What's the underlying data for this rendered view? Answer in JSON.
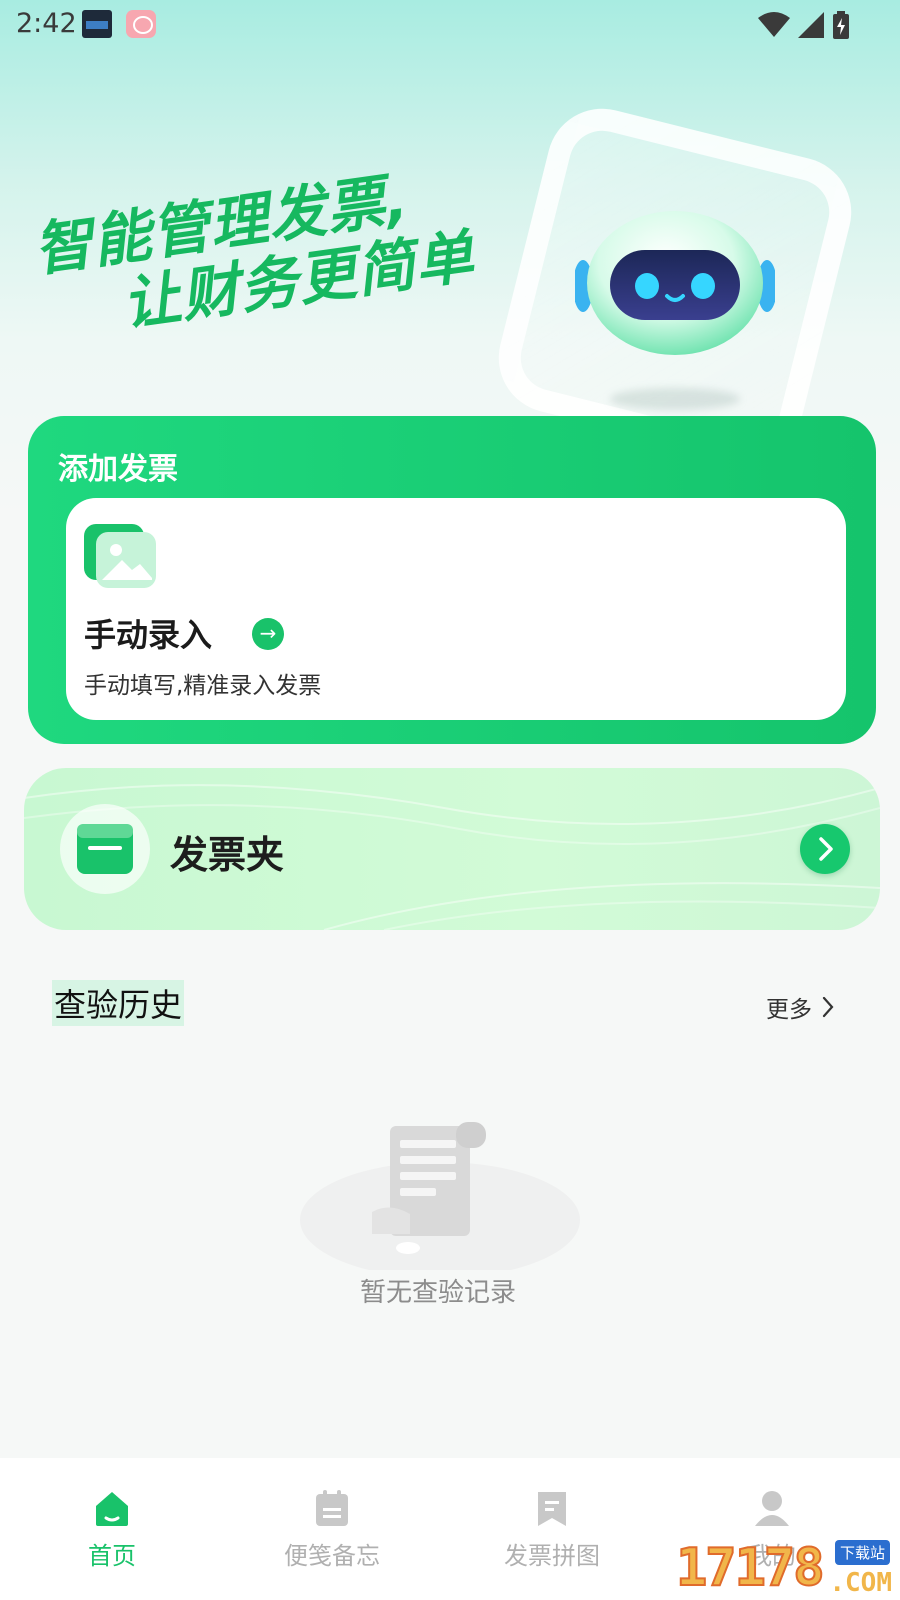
{
  "status_bar": {
    "time": "2:42",
    "icons": [
      "wifi-icon",
      "cellular-signal-icon",
      "battery-charging-icon"
    ]
  },
  "hero": {
    "line1": "智能管理发票,",
    "line2": "让财务更简单"
  },
  "add_invoice": {
    "title": "添加发票",
    "manual": {
      "title": "手动录入",
      "subtitle": "手动填写,精准录入发票",
      "arrow": "→"
    }
  },
  "folder": {
    "title": "发票夹"
  },
  "history": {
    "title": "查验历史",
    "more_label": "更多",
    "empty_text": "暂无查验记录"
  },
  "tabbar": {
    "items": [
      {
        "label": "首页",
        "icon": "home-icon",
        "active": true
      },
      {
        "label": "便笺备忘",
        "icon": "calendar-note-icon",
        "active": false
      },
      {
        "label": "发票拼图",
        "icon": "receipt-icon",
        "active": false
      },
      {
        "label": "我的",
        "icon": "user-icon",
        "active": false
      }
    ]
  },
  "watermark": {
    "number": "17178",
    "tag": "下载站",
    "domain": ".COM"
  },
  "colors": {
    "brand_green": "#19c26a",
    "hero_text": "#16b85f",
    "tab_inactive": "#b0b0b0"
  }
}
